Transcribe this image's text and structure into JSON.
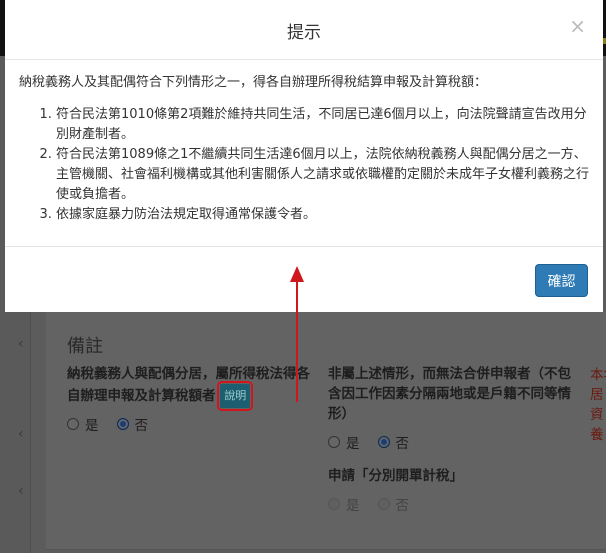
{
  "modal": {
    "title": "提示",
    "close_icon": "×",
    "intro": "納稅義務人及其配偶符合下列情形之一，得各自辦理所得稅結算申報及計算稅額：",
    "items": [
      "符合民法第1010條第2項難於維持共同生活，不同居已達6個月以上，向法院聲請宣告改用分別財產制者。",
      "符合民法第1089條之1不繼續共同生活達6個月以上，法院依納稅義務人與配偶分居之一方、主管機關、社會福利機構或其他利害關係人之請求或依職權酌定關於未成年子女權利義務之行使或負擔者。",
      "依據家庭暴力防治法規定取得通常保護令者。"
    ],
    "confirm_label": "確認"
  },
  "background": {
    "section_title": "備註",
    "q1": {
      "label": "納稅義務人與配偶分居，屬所得稅法得各自辦理申報及計算稅額者",
      "help_label": "說明",
      "yes": "是",
      "no": "否",
      "selected": "否"
    },
    "q2": {
      "label": "非屬上述情形，而無法合併申報者（不包含因工作因素分隔兩地或是戶籍不同等情形）",
      "yes": "是",
      "no": "否",
      "selected": "否"
    },
    "q3": {
      "label": "申請「分別開單計稅」",
      "yes": "是",
      "no": "否",
      "selected": "否",
      "disabled": true
    },
    "side_note_lines": [
      "本年",
      "居",
      "資",
      "養"
    ]
  },
  "colors": {
    "annotation": "#d0161d",
    "primary": "#2e7bb5"
  }
}
